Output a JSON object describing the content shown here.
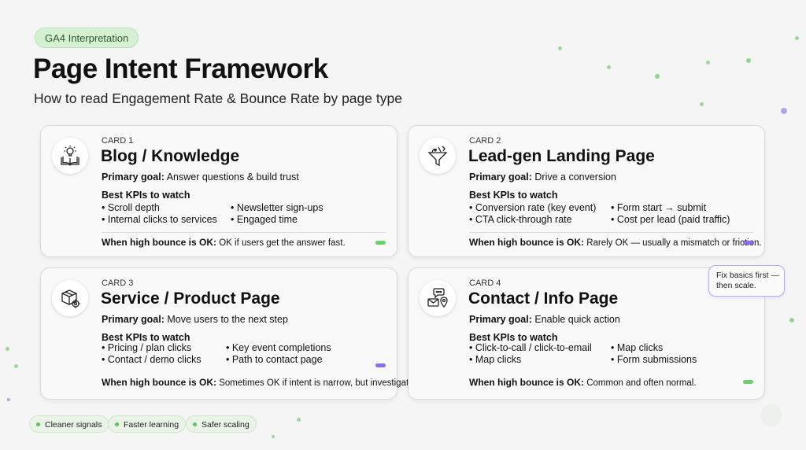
{
  "header": {
    "pill": "GA4 Interpretation",
    "title": "Page Intent Framework",
    "subtitle": "How to read Engagement Rate & Bounce Rate by page type"
  },
  "labels": {
    "primary_goal": "Primary goal:",
    "kpis_heading": "Best KPIs to watch",
    "bounce_ok": "When high bounce is OK:"
  },
  "cards": [
    {
      "num": "CARD 1",
      "title": "Blog / Knowledge",
      "icon": "book-lightbulb-icon",
      "goal": "Answer questions & build trust",
      "kpis_left": [
        "• Scroll depth",
        "• Internal clicks to services"
      ],
      "kpis_right": [
        "• Newsletter sign-ups",
        "• Engaged time"
      ],
      "bounce": "OK if users get the answer fast.",
      "indicator_color": "#6bd16b"
    },
    {
      "num": "CARD 2",
      "title": "Lead-gen Landing Page",
      "icon": "funnel-icon",
      "goal": "Drive a conversion",
      "kpis_left": [
        "• Conversion rate (key event)",
        "• CTA click-through rate"
      ],
      "kpis_right": [
        "• Form start → submit",
        "• Cost per lead (paid traffic)"
      ],
      "bounce": "Rarely OK — usually a mismatch or friction.",
      "indicator_color": "#8a6df0"
    },
    {
      "num": "CARD 3",
      "title": "Service / Product Page",
      "icon": "box-gear-icon",
      "goal": "Move users to the next step",
      "kpis_left": [
        "• Pricing / plan clicks",
        "• Contact / demo clicks"
      ],
      "kpis_right": [
        "• Key event completions",
        "• Path to contact page"
      ],
      "bounce": "Sometimes OK if intent is narrow, but investigate.",
      "indicator_color": "#8a6df0"
    },
    {
      "num": "CARD 4",
      "title": "Contact / Info Page",
      "icon": "contact-icon",
      "goal": "Enable quick action",
      "kpis_left": [
        "• Click-to-call / click-to-email",
        "• Map clicks"
      ],
      "kpis_right": [
        "• Map clicks",
        "• Form submissions"
      ],
      "bounce": "Common and often normal.",
      "indicator_color": "#6bd16b"
    }
  ],
  "callout": {
    "line1": "Fix basics first —",
    "line2": "then scale."
  },
  "chips": [
    "Cleaner signals",
    "Faster learning",
    "Safer scaling"
  ],
  "colors": {
    "accent_green": "#6bd16b",
    "accent_purple": "#8a6df0",
    "background": "#f4f5f4"
  }
}
